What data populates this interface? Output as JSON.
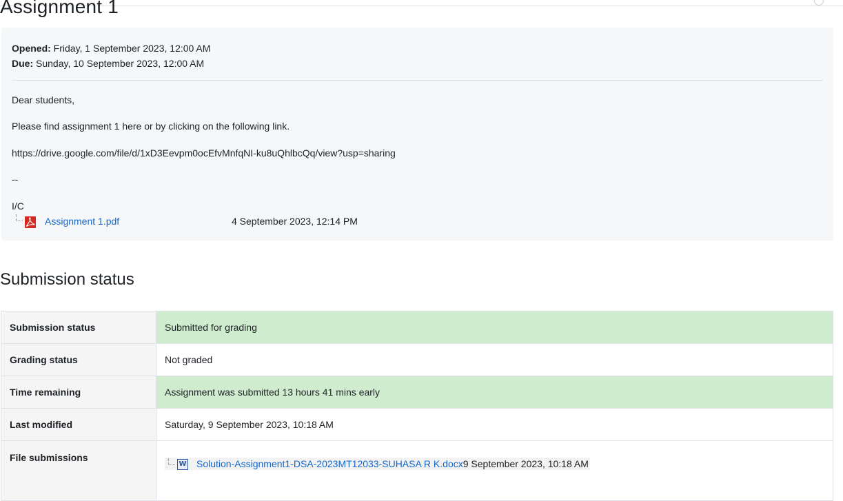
{
  "page": {
    "title": "Assignment 1"
  },
  "dates": {
    "opened_label": "Opened:",
    "opened_value": "Friday, 1 September 2023, 12:00 AM",
    "due_label": "Due:",
    "due_value": "Sunday, 10 September 2023, 12:00 AM"
  },
  "description": {
    "greeting": "Dear students,",
    "instruction": "Please find assignment 1 here or by clicking on the following link.",
    "link": "https://drive.google.com/file/d/1xD3Eevpm0ocEfvMnfqNI-ku8uQhlbcQq/view?usp=sharing",
    "separator": "--",
    "signature": "I/C"
  },
  "attachment": {
    "icon": "pdf-file-icon",
    "name": "Assignment 1.pdf",
    "date": "4 September 2023, 12:14 PM"
  },
  "submission": {
    "heading": "Submission status",
    "rows": [
      {
        "label": "Submission status",
        "value": "Submitted for grading",
        "status": "success"
      },
      {
        "label": "Grading status",
        "value": "Not graded"
      },
      {
        "label": "Time remaining",
        "value": "Assignment was submitted 13 hours 41 mins early",
        "status": "success"
      },
      {
        "label": "Last modified",
        "value": "Saturday, 9 September 2023, 10:18 AM"
      },
      {
        "label": "File submissions"
      }
    ],
    "file": {
      "icon": "word-document-icon",
      "name": "Solution-Assignment1-DSA-2023MT12033-SUHASA R K.docx",
      "date": "9 September 2023, 10:18 AM"
    }
  },
  "colors": {
    "success_bg": "#cfeccf",
    "link": "#1467c9",
    "panel_bg": "#f6f7f8"
  }
}
